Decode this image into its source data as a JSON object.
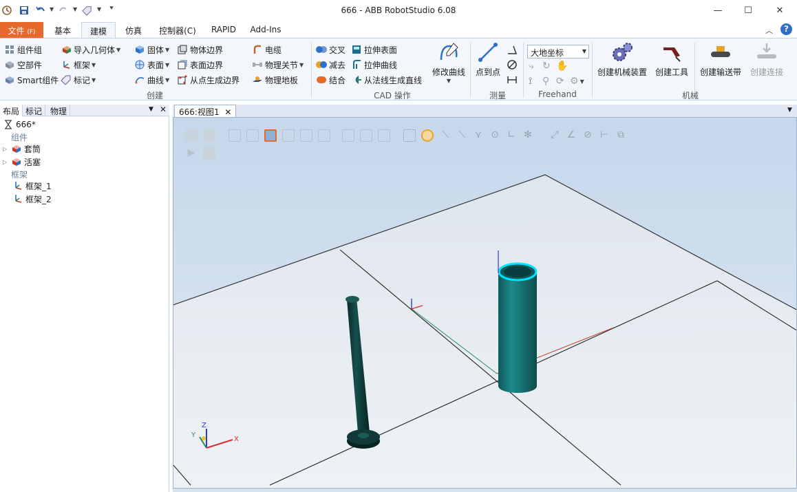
{
  "window": {
    "title": "666 - ABB RobotStudio 6.08",
    "minimize_glyph": "—",
    "maximize_glyph": "☐",
    "close_glyph": "✕"
  },
  "ribbon_tabs": [
    {
      "label": "文件",
      "accel": "(F)"
    },
    {
      "label": "基本"
    },
    {
      "label": "建模"
    },
    {
      "label": "仿真"
    },
    {
      "label": "控制器(C)"
    },
    {
      "label": "RAPID"
    },
    {
      "label": "Add-Ins"
    }
  ],
  "ribbon": {
    "create": {
      "group_label": "创建",
      "component_group": "组件组",
      "empty_part": "空部件",
      "smart_component": "Smart组件",
      "import_geometry": "导入几何体",
      "frame": "框架",
      "tag": "标记",
      "solid": "固体",
      "surface": "表面",
      "curve": "曲线",
      "body_border": "物体边界",
      "surface_border": "表面边界",
      "border_from_points": "从点生成边界"
    },
    "physics": {
      "cable": "电缆",
      "physical_joint": "物理关节",
      "physical_floor": "物理地板"
    },
    "cad": {
      "group_label": "CAD 操作",
      "intersect": "交叉",
      "subtract": "减去",
      "union": "结合",
      "extrude_surface": "拉伸表面",
      "extrude_curve": "拉伸曲线",
      "line_from_normal": "从法线生成直线",
      "modify_curve": "修改曲线"
    },
    "measure": {
      "group_label": "测量",
      "point_to_point": "点到点"
    },
    "freehand": {
      "group_label": "Freehand",
      "coord_system": "大地坐标"
    },
    "mechanism": {
      "group_label": "机械",
      "create_mechanism": "创建机械装置",
      "create_tool": "创建工具",
      "create_conveyor": "创建输送带",
      "create_connection": "创建连接"
    }
  },
  "left_panel": {
    "tabs": [
      "布局",
      "标记",
      "物理"
    ],
    "tree": {
      "station": "666*",
      "components_header": "组件",
      "components": [
        "套筒",
        "活塞"
      ],
      "frames_header": "框架",
      "frames": [
        "框架_1",
        "框架_2"
      ]
    }
  },
  "document_tab": {
    "label": "666:视图1"
  },
  "viewport": {
    "axis_labels": {
      "x": "X",
      "y": "Y",
      "z": "Z"
    },
    "colors": {
      "background_top": "#c5d7ea",
      "floor": "#e6ecf1",
      "cylinder": "#1a6f6f",
      "rod": "#0f3a38",
      "highlight": "#00e5ff"
    }
  }
}
